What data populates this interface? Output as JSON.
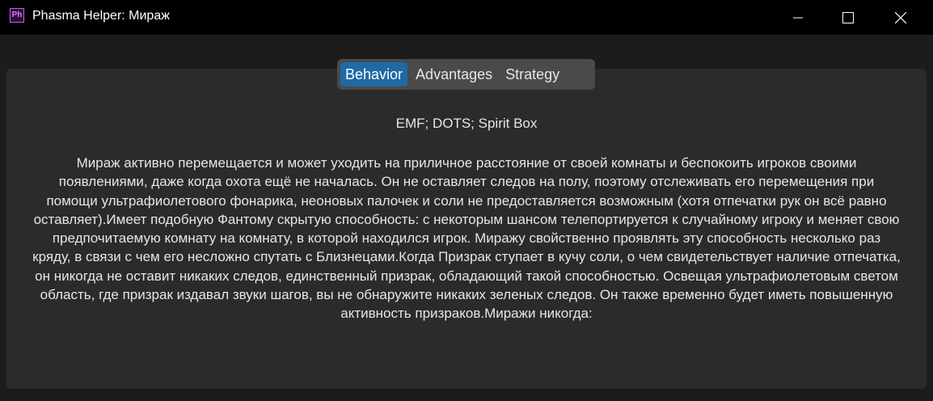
{
  "window": {
    "title": "Phasma Helper: Мираж",
    "icon_label": "Ph",
    "icon": "phasma-app-icon",
    "controls": [
      "minimize-icon",
      "maximize-icon",
      "close-icon"
    ]
  },
  "tabs": [
    {
      "label": "Behavior",
      "active": true
    },
    {
      "label": "Advantages",
      "active": false
    },
    {
      "label": "Strategy",
      "active": false
    }
  ],
  "content": {
    "evidence": "EMF; DOTS; Spirit Box",
    "description": "Мираж активно перемещается и может уходить на приличное расстояние от своей комнаты и беспокоить игроков своими появлениями, даже когда охота ещё не началась. Он не оставляет следов на полу, поэтому отслеживать его перемещения при помощи ультрафиолетового фонарика, неоновых палочек и соли не предоставляется возможным (хотя отпечатки рук он всё равно оставляет).Имеет подобную Фантому скрытую способность: с некоторым шансом телепортируется к случайному игроку и меняет свою предпочитаемую комнату на комнату, в которой находился игрок. Миражу свойственно проявлять эту способность несколько раз кряду, в связи с чем его несложно спутать с Близнецами.Когда Призрак ступает в кучу соли, о чем свидетельствует наличие отпечатка, он никогда не оставит никаких следов, единственный призрак, обладающий такой способностью. Освещая ультрафиолетовым светом область, где призрак издавал звуки шагов, вы не обнаружите никаких зеленых следов. Он также временно будет иметь повышенную активность призраков.Миражи никогда:"
  },
  "colors": {
    "titlebar": "#000000",
    "background": "#1c1c1c",
    "panel": "#2b2b2b",
    "tabbar": "#4a4a4a",
    "tab_active": "#1f6aa5",
    "text": "#e6e6e6"
  }
}
